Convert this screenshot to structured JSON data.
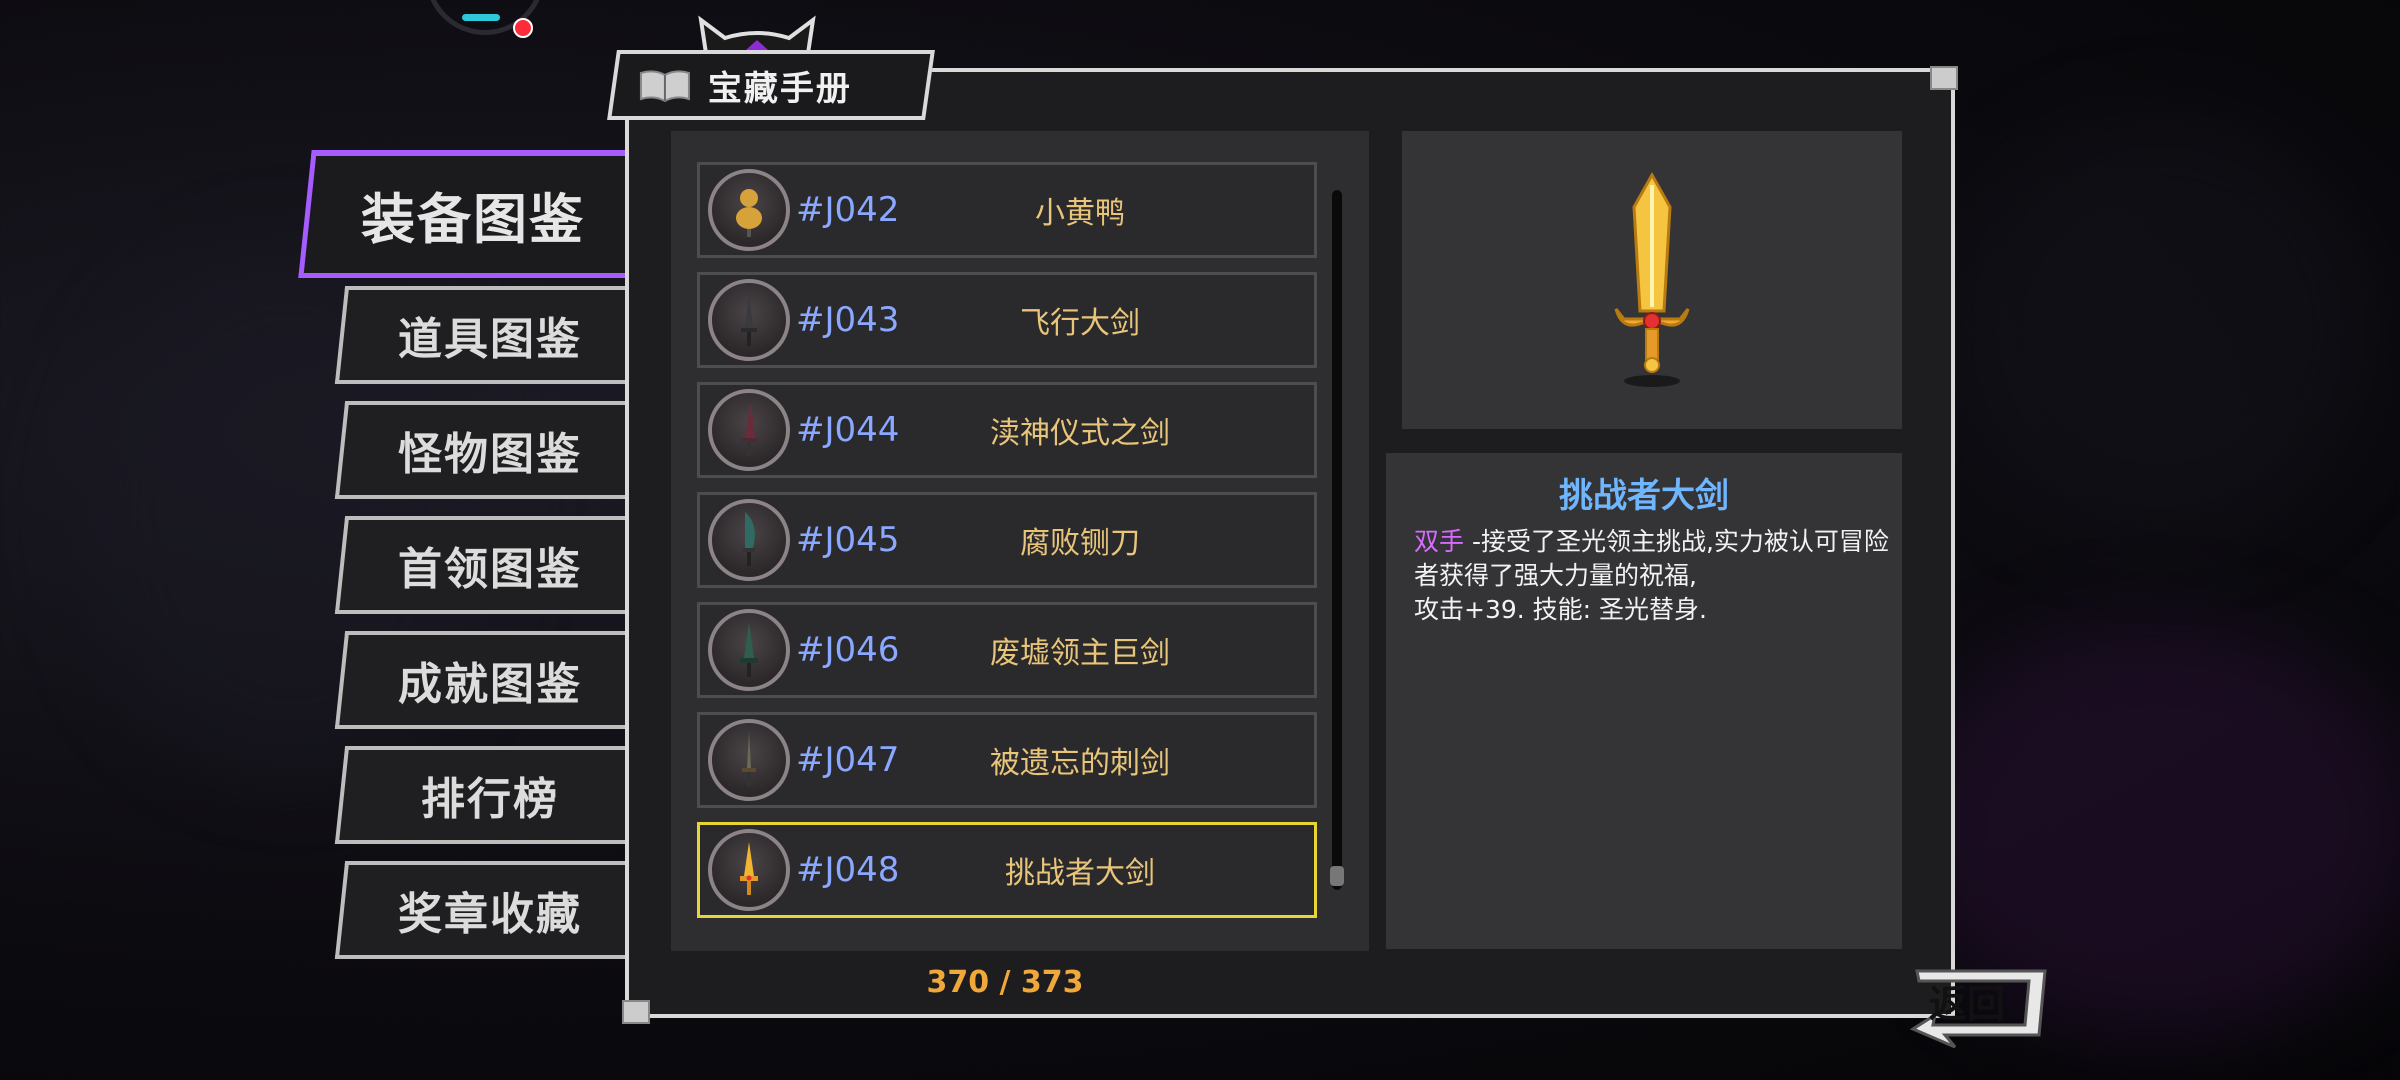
{
  "title": "宝藏手册",
  "tabs": [
    {
      "label": "装备图鉴",
      "active": true
    },
    {
      "label": "道具图鉴",
      "active": false
    },
    {
      "label": "怪物图鉴",
      "active": false
    },
    {
      "label": "首领图鉴",
      "active": false
    },
    {
      "label": "成就图鉴",
      "active": false
    },
    {
      "label": "排行榜",
      "active": false
    },
    {
      "label": "奖章收藏",
      "active": false
    }
  ],
  "items": [
    {
      "code": "#J042",
      "name": "小黄鸭",
      "icon": "duck-icon",
      "selected": false
    },
    {
      "code": "#J043",
      "name": "飞行大剑",
      "icon": "sword-icon",
      "selected": false
    },
    {
      "code": "#J044",
      "name": "渎神仪式之剑",
      "icon": "sword-icon",
      "selected": false
    },
    {
      "code": "#J045",
      "name": "腐败铡刀",
      "icon": "blade-icon",
      "selected": false
    },
    {
      "code": "#J046",
      "name": "废墟领主巨剑",
      "icon": "sword-icon",
      "selected": false
    },
    {
      "code": "#J047",
      "name": "被遗忘的刺剑",
      "icon": "rapier-icon",
      "selected": false
    },
    {
      "code": "#J048",
      "name": "挑战者大剑",
      "icon": "golden-sword-icon",
      "selected": true
    }
  ],
  "counter": "370 / 373",
  "detail": {
    "name": "挑战者大剑",
    "tag": "双手",
    "line1": " -接受了圣光领主挑战,实力被认可冒险者获得了强大力量的祝福,",
    "line2": "攻击+39. 技能: 圣光替身."
  },
  "back_label": "返回",
  "colors": {
    "active_tab_border": "#a65cff",
    "selected_row_border": "#e7d437",
    "item_code": "#8aa8ff",
    "item_name": "#e8c57a",
    "counter": "#f0a83a",
    "detail_title": "#6fb6ff",
    "tag": "#d86bff"
  }
}
